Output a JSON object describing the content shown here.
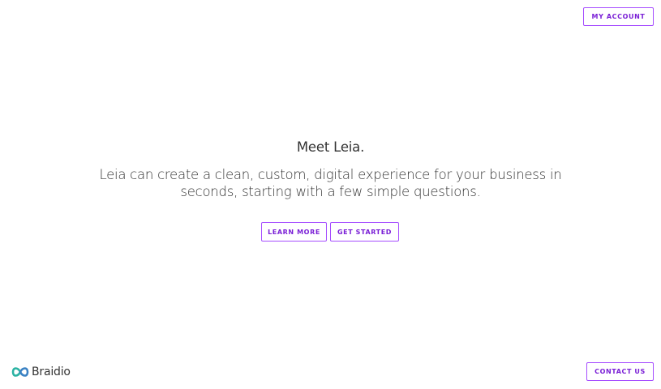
{
  "header": {
    "my_account_label": "MY ACCOUNT"
  },
  "hero": {
    "title": "Meet Leia.",
    "description": "Leia can create a clean, custom, digital experience for your business in seconds, starting with a few simple questions.",
    "learn_more_label": "LEARN MORE",
    "get_started_label": "GET STARTED"
  },
  "footer": {
    "brand_name": "Braidio",
    "brand_icon": "braidio-logo-icon",
    "contact_us_label": "CONTACT US"
  },
  "colors": {
    "accent": "#7a1fd6",
    "button_border": "#a64dff",
    "text": "#333333",
    "logo_teal": "#2bb3a3",
    "logo_blue": "#3b82c4"
  }
}
